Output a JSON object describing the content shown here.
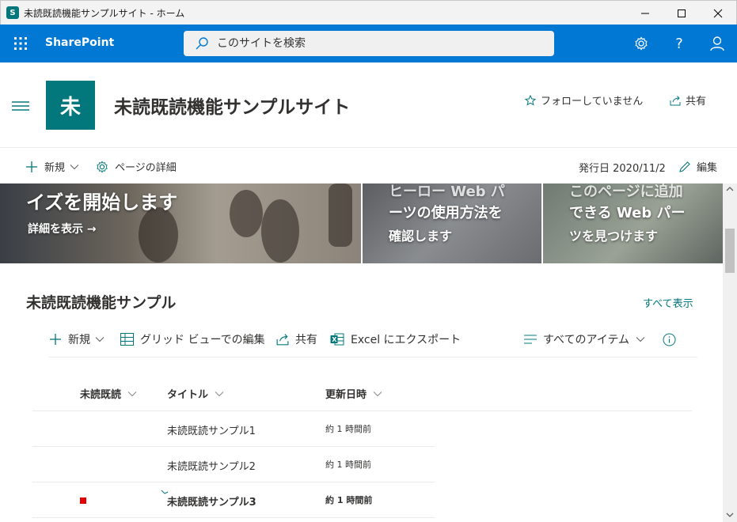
{
  "window": {
    "title": "未読既読機能サンプルサイト - ホーム",
    "app_icon_letter": "S"
  },
  "suitebar": {
    "brand": "SharePoint",
    "search_placeholder": "このサイトを検索",
    "accent": "#0078d4",
    "icons": [
      "waffle-icon",
      "gear-icon",
      "help-icon",
      "person-icon"
    ]
  },
  "site": {
    "logo_letter": "未",
    "logo_color": "#03787c",
    "title": "未読既読機能サンプルサイト",
    "follow_label": "フォローしていません",
    "share_label": "共有"
  },
  "page_commands": {
    "new_label": "新規",
    "details_label": "ページの詳細",
    "published": "発行日 2020/11/2",
    "edit_label": "編集"
  },
  "hero": {
    "tile1": {
      "heading": "イズを開始します",
      "link": "詳細を表示 →"
    },
    "tile2": {
      "line1": "ヒーロー Web パ",
      "line2": "ーツの使用方法を",
      "line3": "確認します"
    },
    "tile3": {
      "line1": "このページに追加",
      "line2": "できる Web パー",
      "line3": "ツを見つけます"
    }
  },
  "list": {
    "title": "未読既読機能サンプル",
    "see_all": "すべて表示",
    "commands": {
      "new": "新規",
      "grid_edit": "グリッド ビューでの編集",
      "share": "共有",
      "export": "Excel にエクスポート",
      "view": "すべてのアイテム"
    },
    "columns": [
      "未読既読",
      "タイトル",
      "更新日時"
    ],
    "rows": [
      {
        "unread": false,
        "title": "未読既読サンプル1",
        "modified": "約 1 時間前"
      },
      {
        "unread": false,
        "title": "未読既読サンプル2",
        "modified": "約 1 時間前"
      },
      {
        "unread": true,
        "title": "未読既読サンプル3",
        "modified": "約 1 時間前"
      }
    ]
  }
}
